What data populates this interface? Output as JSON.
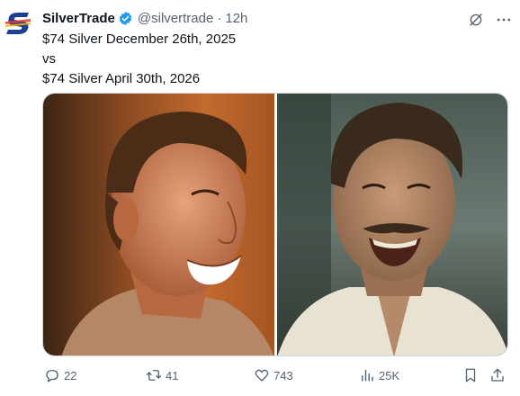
{
  "tweet": {
    "display_name": "SilverTrade",
    "handle": "@silvertrade",
    "separator": "·",
    "time": "12h",
    "lines": [
      "$74 Silver December 26th, 2025",
      "vs",
      "$74 Silver April 30th, 2026"
    ]
  },
  "media": {
    "left_alt": "",
    "right_alt": ""
  },
  "actions": {
    "replies": "22",
    "reposts": "41",
    "likes": "743",
    "views": "25K"
  },
  "icons": {
    "verified": "verified-badge-icon",
    "grok": "grok-icon",
    "more": "more-icon",
    "reply": "reply-icon",
    "repost": "repost-icon",
    "like": "like-icon",
    "views": "views-icon",
    "bookmark": "bookmark-icon",
    "share": "share-icon"
  },
  "colors": {
    "verified_blue": "#1d9bf0",
    "text_primary": "#0f1419",
    "text_secondary": "#536471",
    "logo_blue": "#1c3f94"
  }
}
